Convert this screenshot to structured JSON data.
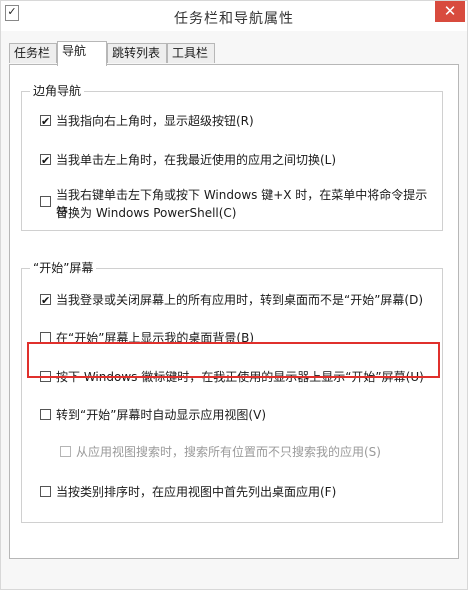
{
  "window": {
    "title": "任务栏和导航属性",
    "app_icon": "✓",
    "close_glyph": "✕"
  },
  "tabs": [
    {
      "label": "任务栏",
      "active": false
    },
    {
      "label": "导航",
      "active": true
    },
    {
      "label": "跳转列表",
      "active": false
    },
    {
      "label": "工具栏",
      "active": false
    }
  ],
  "corner_nav": {
    "title": "边角导航",
    "options": [
      {
        "label": "当我指向右上角时，显示超级按钮(R)",
        "checked": true
      },
      {
        "label": "当我单击左上角时，在我最近使用的应用之间切换(L)",
        "checked": true
      },
      {
        "label_line1": "当我右键单击左下角或按下 Windows 键+X 时，在菜单中将命令提示符",
        "label_line2": "替换为 Windows PowerShell(C)",
        "checked": false
      }
    ]
  },
  "start_screen": {
    "title": "“开始”屏幕",
    "options": [
      {
        "label": "当我登录或关闭屏幕上的所有应用时，转到桌面而不是“开始”屏幕(D)",
        "checked": true
      },
      {
        "label": "在“开始”屏幕上显示我的桌面背景(B)",
        "checked": false
      },
      {
        "label": "按下 Windows 徽标键时，在我正使用的显示器上显示“开始”屏幕(U)",
        "checked": false
      },
      {
        "label": "转到“开始”屏幕时自动显示应用视图(V)",
        "checked": false
      },
      {
        "label": "从应用视图搜索时，搜索所有位置而不只搜索我的应用(S)",
        "checked": false,
        "disabled": true
      },
      {
        "label": "当按类别排序时，在应用视图中首先列出桌面应用(F)",
        "checked": false
      }
    ]
  },
  "colors": {
    "highlight_border": "#e0302c",
    "close_button": "#d84b3e"
  }
}
